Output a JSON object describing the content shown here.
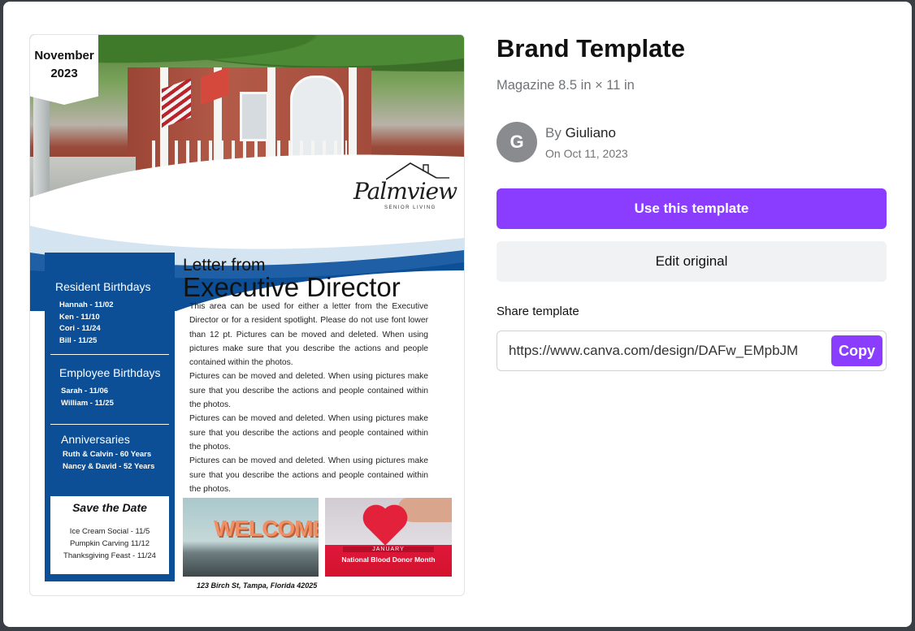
{
  "preview": {
    "month": "November",
    "year": "2023",
    "logo_name": "Palmview",
    "logo_sub": "SENIOR LIVING",
    "letter_heading_small": "Letter from",
    "letter_heading_big": "Executive Director",
    "body": [
      "This area can be used for either a letter from the Executive Director or for a resident spotlight. Please do not use font lower than 12 pt. Pictures can be moved and deleted. When using pictures make sure that you describe the actions and people contained within the photos.",
      "Pictures can be moved and deleted. When using pictures make sure that you describe the actions and people contained within the photos.",
      "Pictures can be moved and deleted. When using pictures make sure that you describe the actions and people contained within the photos.",
      "Pictures can be moved and deleted. When using pictures make sure that you describe the actions and people contained within the photos."
    ],
    "resident_birthdays": {
      "title": "Resident Birthdays",
      "items": [
        "Hannah - 11/02",
        "Ken - 11/10",
        "Cori - 11/24",
        "Bill - 11/25"
      ]
    },
    "employee_birthdays": {
      "title": "Employee Birthdays",
      "items": [
        "Sarah - 11/06",
        "William - 11/25"
      ]
    },
    "anniversaries": {
      "title": "Anniversaries",
      "items": [
        "Ruth & Calvin - 60 Years",
        "Nancy & David - 52 Years"
      ]
    },
    "save_the_date": {
      "title": "Save the Date",
      "items": [
        "Ice Cream Social - 11/5",
        "Pumpkin Carving 11/12",
        "Thanksgiving Feast - 11/24"
      ]
    },
    "welcome_text": "WELCOME",
    "january_label": "JANUARY",
    "blood_donor": "National Blood Donor Month",
    "address": "123 Birch St, Tampa, Florida 42025"
  },
  "panel": {
    "title": "Brand Template",
    "subtitle": "Magazine 8.5 in × 11 in",
    "avatar_initial": "G",
    "by_prefix": "By",
    "author": "Giuliano",
    "date": "On Oct 11, 2023",
    "use_button": "Use this template",
    "edit_button": "Edit original",
    "share_label": "Share template",
    "share_url": "https://www.canva.com/design/DAFw_EMpbJM",
    "copy_button": "Copy"
  },
  "colors": {
    "accent": "#8b3dff",
    "newsletter_blue": "#0d4f96"
  }
}
